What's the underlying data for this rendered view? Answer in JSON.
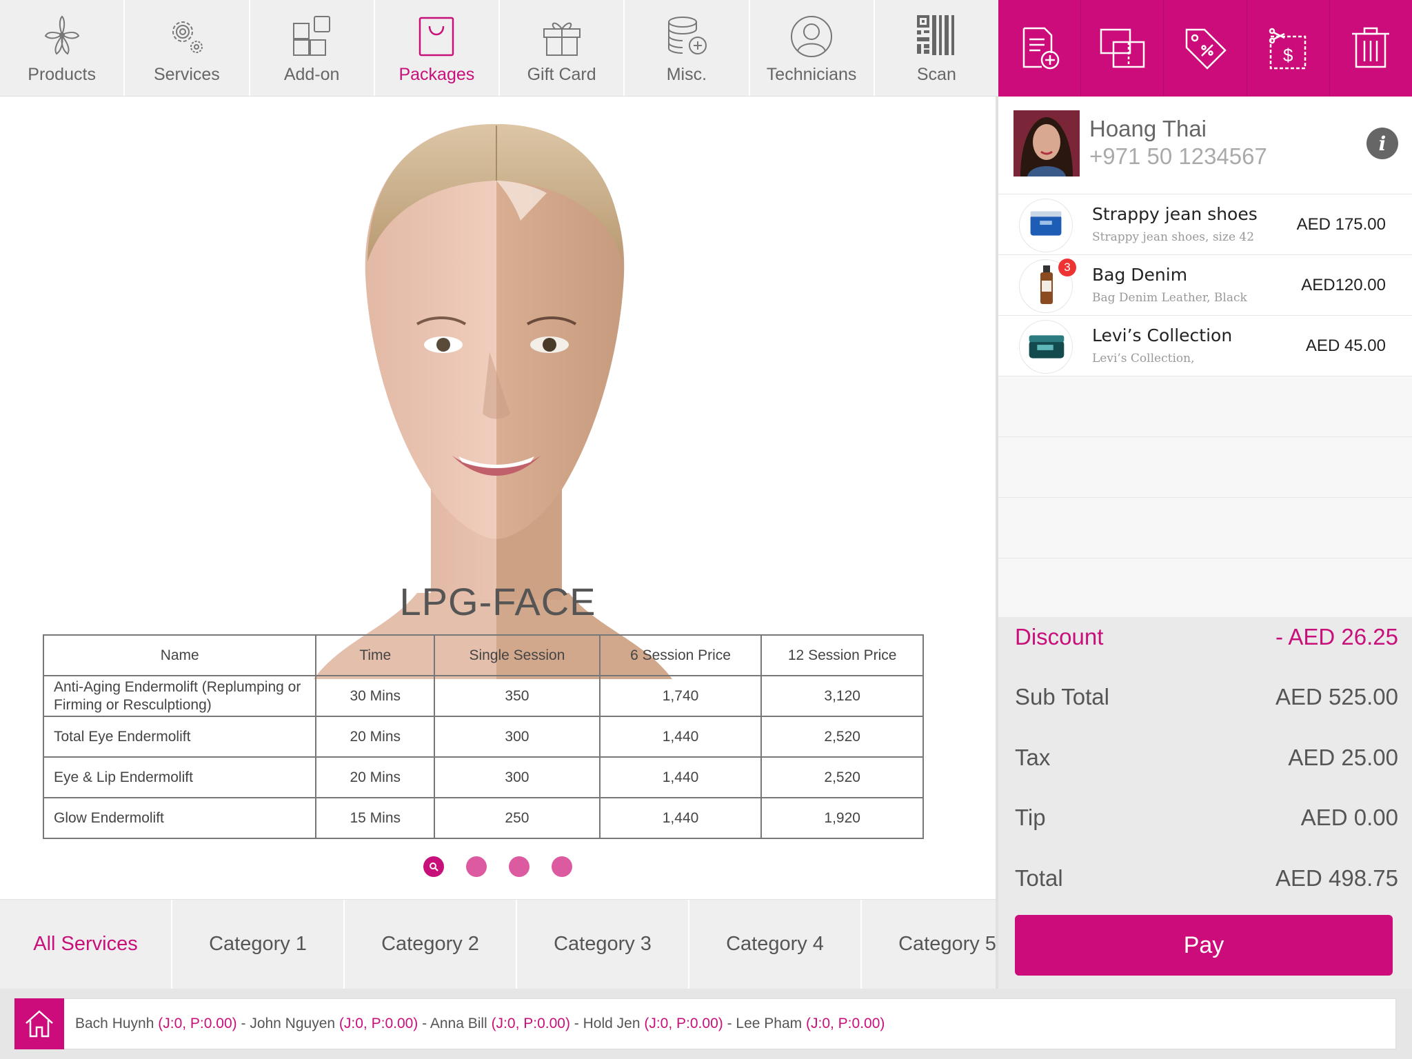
{
  "nav": {
    "items": [
      {
        "label": "Products",
        "icon": "orchid-icon"
      },
      {
        "label": "Services",
        "icon": "gears-icon"
      },
      {
        "label": "Add-on",
        "icon": "blocks-icon"
      },
      {
        "label": "Packages",
        "icon": "bag-icon",
        "active": true
      },
      {
        "label": "Gift Card",
        "icon": "gift-icon"
      },
      {
        "label": "Misc.",
        "icon": "coins-icon"
      },
      {
        "label": "Technicians",
        "icon": "person-icon"
      },
      {
        "label": "Scan",
        "icon": "qr-icon"
      }
    ]
  },
  "actions": [
    {
      "icon": "add-note-icon"
    },
    {
      "icon": "split-icon"
    },
    {
      "icon": "discount-tag-icon"
    },
    {
      "icon": "coupon-icon"
    },
    {
      "icon": "trash-icon"
    }
  ],
  "package": {
    "title": "LPG-FACE",
    "columns": [
      "Name",
      "Time",
      "Single Session",
      "6 Session Price",
      "12 Session Price"
    ],
    "rows": [
      [
        "Anti-Aging Endermolift (Replumping or Firming or Resculptiong)",
        "30 Mins",
        "350",
        "1,740",
        "3,120"
      ],
      [
        "Total Eye Endermolift",
        "20 Mins",
        "300",
        "1,440",
        "2,520"
      ],
      [
        "Eye & Lip Endermolift",
        "20 Mins",
        "300",
        "1,440",
        "2,520"
      ],
      [
        "Glow Endermolift",
        "15 Mins",
        "250",
        "1,440",
        "1,920"
      ]
    ],
    "page_dots": 4,
    "active_dot": 0
  },
  "categories": [
    {
      "label": "All Services",
      "active": true
    },
    {
      "label": "Category 1"
    },
    {
      "label": "Category 2"
    },
    {
      "label": "Category 3"
    },
    {
      "label": "Category 4"
    },
    {
      "label": "Category 5"
    }
  ],
  "technicians": [
    {
      "name": "Bach Huynh",
      "stat": "(J:0, P:0.00)"
    },
    {
      "name": "John Nguyen",
      "stat": "(J:0, P:0.00)"
    },
    {
      "name": "Anna Bill",
      "stat": "(J:0, P:0.00)"
    },
    {
      "name": "Hold Jen",
      "stat": "(J:0, P:0.00)"
    },
    {
      "name": "Lee Pham",
      "stat": "(J:0, P:0.00)"
    }
  ],
  "customer": {
    "name": "Hoang Thai",
    "phone": "+971 50 1234567"
  },
  "cart": {
    "items": [
      {
        "name": "Strappy jean shoes",
        "desc": "Strappy jean shoes, size 42",
        "price": "AED 175.00",
        "thumb": "cream-jar",
        "badge": ""
      },
      {
        "name": "Bag Denim",
        "desc": "Bag Denim Leather, Black",
        "price": "AED120.00",
        "thumb": "serum-bottle",
        "badge": "3"
      },
      {
        "name": "Levi’s Collection",
        "desc": "Levi’s Collection,",
        "price": "AED 45.00",
        "thumb": "mask-jar",
        "badge": ""
      }
    ],
    "empty_rows": 3
  },
  "totals": {
    "discount_label": "Discount",
    "discount": "- AED 26.25",
    "subtotal_label": "Sub Total",
    "subtotal": "AED 525.00",
    "tax_label": "Tax",
    "tax": "AED 25.00",
    "tip_label": "Tip",
    "tip": "AED 0.00",
    "total_label": "Total",
    "total": "AED 498.75",
    "pay_label": "Pay"
  },
  "colors": {
    "accent": "#cd0c7b",
    "accent_light": "#dc5aa0"
  }
}
